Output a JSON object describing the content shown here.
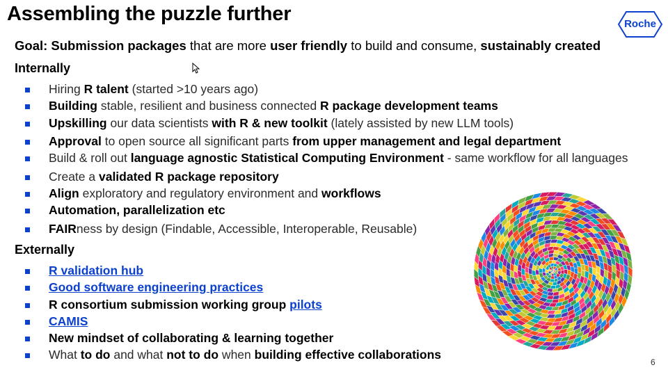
{
  "slide": {
    "title": "Assembling the puzzle further",
    "logo_text": "Roche",
    "page_number": "6",
    "goal": {
      "p1": "Goal: Submission packages",
      "p2": " that are more ",
      "p3": "user friendly",
      "p4": " to build and consume, ",
      "p5": "sustainably created"
    },
    "internally": {
      "heading": "Internally",
      "b1": {
        "p1": "Hiring ",
        "p2": "R talent",
        "p3": " (started >10 years ago)"
      },
      "b2": {
        "p1": "Building",
        "p2": " stable, resilient and business connected ",
        "p3": "R package development teams"
      },
      "b3": {
        "p1": "Upskilling",
        "p2": " our data scientists ",
        "p3": "with R & new toolkit",
        "p4": " (lately assisted by new LLM tools)"
      },
      "b4": {
        "p1": "Approval",
        "p2": " to open source all significant parts ",
        "p3": "from upper management and legal department"
      },
      "b5": {
        "p1": "Build & roll out ",
        "p2": "language agnostic Statistical Computing Environment",
        "p3": " - same workflow for all languages"
      },
      "b6": {
        "p1": "Create a ",
        "p2": "validated R package repository"
      },
      "b7": {
        "p1": "Align",
        "p2": " exploratory and regulatory environment and ",
        "p3": "workflows"
      },
      "b8": {
        "p1": "Automation, parallelization etc"
      },
      "b9": {
        "p1": "FAIR",
        "p2": "ness by design (Findable, Accessible, Interoperable, Reusable)"
      }
    },
    "externally": {
      "heading": "Externally",
      "b1": {
        "link": "R validation hub"
      },
      "b2": {
        "link": "Good software engineering practices"
      },
      "b3": {
        "p1": "R consortium submission working group ",
        "link": "pilots"
      },
      "b4": {
        "link": "CAMIS"
      },
      "b5": {
        "p1": "New mindset of collaborating & learning together"
      },
      "b6": {
        "p1": "What ",
        "p2": "to do",
        "p3": " and what ",
        "p4": "not to do",
        "p5": " when ",
        "p6": "building effective collaborations"
      }
    }
  },
  "colors": {
    "accent": "#0b41cd",
    "text": "#000000"
  },
  "icons": {
    "logo": "roche-hexagon-logo",
    "cursor": "mouse-pointer-icon",
    "illustration": "puzzle-spiral-image"
  }
}
